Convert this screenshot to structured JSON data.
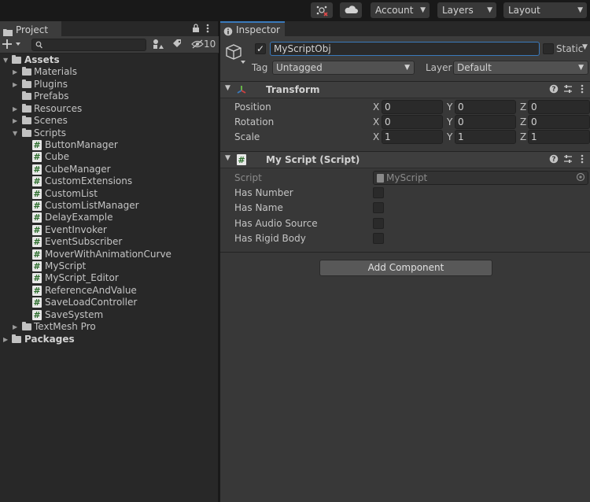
{
  "toolbar": {
    "account": "Account",
    "layers": "Layers",
    "layout": "Layout"
  },
  "project": {
    "tab_title": "Project",
    "hidden_count": "10",
    "search_placeholder": "",
    "tree": {
      "assets": "Assets",
      "materials": "Materials",
      "plugins": "Plugins",
      "prefabs": "Prefabs",
      "resources": "Resources",
      "scenes": "Scenes",
      "scripts": "Scripts",
      "script_files": [
        "ButtonManager",
        "Cube",
        "CubeManager",
        "CustomExtensions",
        "CustomList",
        "CustomListManager",
        "DelayExample",
        "EventInvoker",
        "EventSubscriber",
        "MoverWithAnimationCurve",
        "MyScript",
        "MyScript_Editor",
        "ReferenceAndValue",
        "SaveLoadController",
        "SaveSystem"
      ],
      "textmesh_pro": "TextMesh Pro",
      "packages": "Packages"
    }
  },
  "inspector": {
    "tab_title": "Inspector",
    "object_name": "MyScriptObj",
    "static_label": "Static",
    "tag_label": "Tag",
    "tag_value": "Untagged",
    "layer_label": "Layer",
    "layer_value": "Default",
    "transform": {
      "title": "Transform",
      "position_label": "Position",
      "rotation_label": "Rotation",
      "scale_label": "Scale",
      "position": {
        "x": "0",
        "y": "0",
        "z": "0"
      },
      "rotation": {
        "x": "0",
        "y": "0",
        "z": "0"
      },
      "scale": {
        "x": "1",
        "y": "1",
        "z": "1"
      },
      "axis_x": "X",
      "axis_y": "Y",
      "axis_z": "Z"
    },
    "my_script": {
      "title": "My Script (Script)",
      "script_label": "Script",
      "script_value": "MyScript",
      "has_number": "Has Number",
      "has_name": "Has Name",
      "has_audio_source": "Has Audio Source",
      "has_rigid_body": "Has Rigid Body"
    },
    "add_component": "Add Component"
  },
  "colors": {
    "accent_blue": "#3a79bb",
    "panel_dark": "#282828",
    "panel": "#383838",
    "script_icon_green": "#2d6e2d"
  }
}
